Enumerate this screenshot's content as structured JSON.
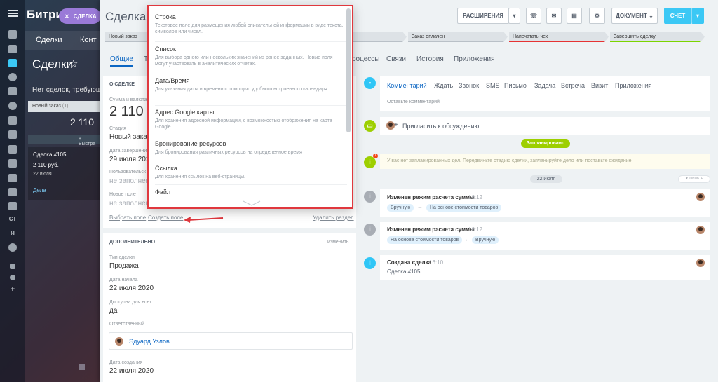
{
  "brand": "Битрикс",
  "mini_btn": "СДЕЛКА",
  "kanban": {
    "tabs": [
      "Сделки",
      "Конт"
    ],
    "title": "Сделки",
    "note": "Нет сделок, требующих",
    "column": "Новый заказ",
    "column_count": "(1)",
    "sum": "2 110",
    "add": "+ Быстра",
    "card_title": "Сделка #105",
    "card_sum": "2 110 руб.",
    "card_date": "22 июля",
    "card_link": "Дела"
  },
  "nav_labels": [
    "СТ",
    "Я"
  ],
  "deal": {
    "title": "Сделка #"
  },
  "toolbar": {
    "expand": "РАСШИРЕНИЯ",
    "document": "ДОКУМЕНТ",
    "invoice": "СЧЁТ"
  },
  "stages": [
    {
      "label": "Новый заказ"
    },
    {
      "label": ""
    },
    {
      "label": ""
    },
    {
      "label": "Заказ оплачен"
    },
    {
      "label": "Напечатать чек"
    },
    {
      "label": "Завершить сделку"
    }
  ],
  "tabs": [
    "Общие",
    "Тс",
    "роцессы",
    "Связи",
    "История",
    "Приложения"
  ],
  "about": {
    "header": "О СДЕЛКЕ",
    "sum_label": "Сумма и валюта",
    "sum": "2 110",
    "stage_label": "Стадия",
    "stage": "Новый заказ",
    "close_label": "Дата завершения",
    "close": "29 июля 2020",
    "custom_label": "Пользовательск",
    "custom": "не заполнено",
    "new_label": "Новое поле",
    "new_val": "не заполнено",
    "choose_field": "Выбрать поле",
    "create_field": "Создать поле",
    "delete_section": "Удалить раздел"
  },
  "extra": {
    "header": "ДОПОЛНИТЕЛЬНО",
    "change": "изменить",
    "type_label": "Тип сделки",
    "type": "Продажа",
    "start_label": "Дата начала",
    "start": "22 июля 2020",
    "access_label": "Доступна для всех",
    "access": "да",
    "resp_label": "Ответственный",
    "resp": "Эдуард Узлов",
    "created_label": "Дата создания",
    "created": "22 июля 2020"
  },
  "activity": {
    "tabs": [
      "Комментарий",
      "Ждать",
      "Звонок",
      "SMS",
      "Письмо",
      "Задача",
      "Встреча",
      "Визит",
      "Приложения"
    ],
    "placeholder": "Оставьте комментарий",
    "invite": "Пригласить к обсуждению",
    "planned": "Запланировано",
    "empty": "У вас нет запланированных дел. Передвиньте стадию сделки, запланируйте дело или поставьте ожидание.",
    "badge": "1",
    "date_pill": "22 июля",
    "filter": "ФИЛЬТР"
  },
  "timeline": [
    {
      "title": "Изменен режим расчета суммы",
      "time": "16:12",
      "from": "Вручную",
      "to": "На основе стоимости товаров"
    },
    {
      "title": "Изменен режим расчета суммы",
      "time": "16:12",
      "from": "На основе стоимости товаров",
      "to": "Вручную"
    },
    {
      "title": "Создана сделка",
      "time": "16:10",
      "sub": "Сделка #105"
    }
  ],
  "field_menu": [
    {
      "title": "Строка",
      "desc": "Текстовое поле для размещения любой описательной информации в виде текста, символов или чисел."
    },
    {
      "title": "Список",
      "desc": "Для выбора одного или нескольких значений из ранее заданных. Новые поля могут участвовать в аналитических отчетах."
    },
    {
      "title": "Дата/Время",
      "desc": "Для указания даты и времени с помощью удобного встроенного календаря."
    },
    {
      "title": "Адрес Google карты",
      "desc": "Для хранения адресной информации, с возможностью отображения на карте Google."
    },
    {
      "title": "Бронирование ресурсов",
      "desc": "Для бронирования различных ресурсов на определенное время"
    },
    {
      "title": "Ссылка",
      "desc": "Для хранения ссылок на веб-страницы."
    },
    {
      "title": "Файл",
      "desc": ""
    }
  ],
  "colors": {
    "accent": "#0b66c3",
    "invoice": "#3bc8f5",
    "planned": "#9dcf00",
    "highlight": "#e0383e"
  }
}
